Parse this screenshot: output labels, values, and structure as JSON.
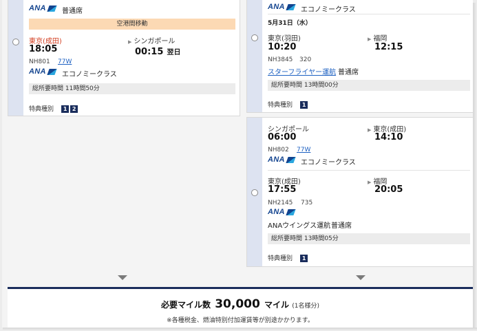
{
  "left": {
    "seg1_partial": {
      "class": "普通席"
    },
    "transfer": "空港間移動",
    "seg2": {
      "from_city": "東京(成田)",
      "from_time": "18:05",
      "to_city": "シンガポール",
      "to_time": "00:15",
      "to_suffix": "翌日",
      "flight": "NH801",
      "aircraft": "77W",
      "class": "エコノミークラス"
    },
    "duration": "総所要時間 11時間50分",
    "award_label": "特典種別",
    "award_badges": [
      "1",
      "2"
    ]
  },
  "right1": {
    "partial_class": "エコノミークラス",
    "date": "5月31日（水）",
    "seg": {
      "from_city": "東京(羽田)",
      "from_time": "10:20",
      "to_city": "福岡",
      "to_time": "12:15",
      "flight": "NH3845",
      "aircraft": "320",
      "operator": "スターフライヤー運航",
      "class": "普通席"
    },
    "duration": "総所要時間 13時間00分",
    "award_label": "特典種別",
    "award_badges": [
      "1"
    ]
  },
  "right2": {
    "seg1": {
      "from_city": "シンガポール",
      "from_time": "06:00",
      "to_city": "東京(成田)",
      "to_time": "14:10",
      "flight": "NH802",
      "aircraft": "77W",
      "class": "エコノミークラス"
    },
    "seg2": {
      "from_city": "東京(成田)",
      "from_time": "17:55",
      "to_city": "福岡",
      "to_time": "20:05",
      "flight": "NH2145",
      "aircraft": "735",
      "operator": "ANAウイングス運航",
      "class": "普通席"
    },
    "duration": "総所要時間 13時間05分",
    "award_label": "特典種別",
    "award_badges": [
      "1"
    ]
  },
  "airline_logo": "ANA",
  "summary": {
    "label": "必要マイル数",
    "miles": "30,000",
    "unit": "マイル",
    "per": "(1名様分)",
    "note": "※各種税金、燃油特別付加運賃等が別途かかります。"
  },
  "colors": {
    "brand": "#13448f",
    "accent": "#1a2d5c",
    "transfer_bg": "#fcd9b4",
    "origin_highlight": "#d23c1e",
    "link": "#1b5fc1"
  }
}
